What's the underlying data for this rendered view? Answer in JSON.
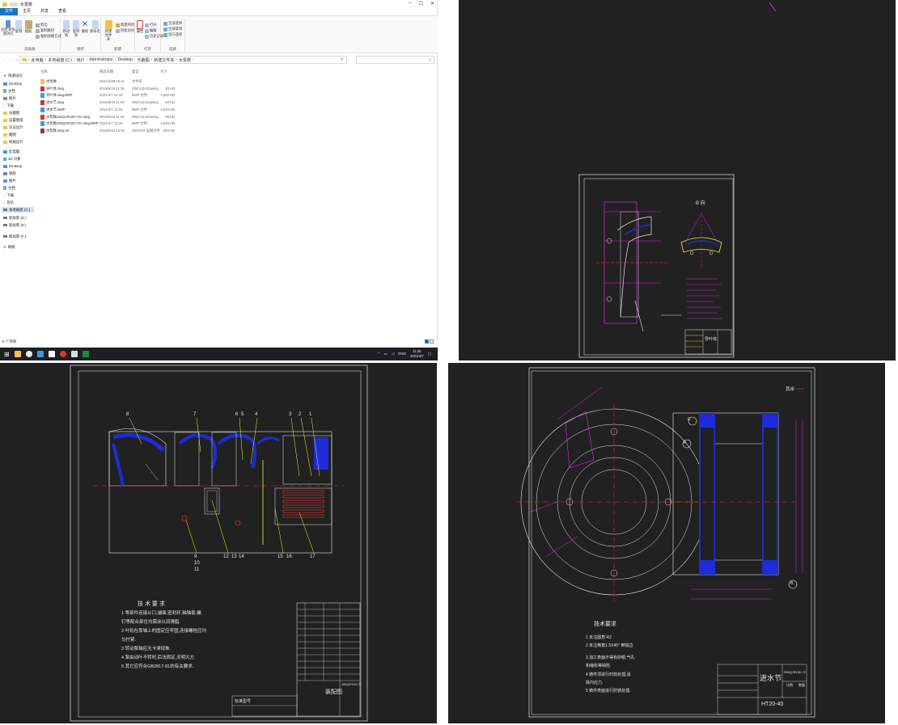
{
  "explorer": {
    "window_title": "水泵数",
    "ribbon_tabs": [
      "文件",
      "主页",
      "共享",
      "查看"
    ],
    "ribbon": {
      "pin_label": "固定到快速访问",
      "copy_label": "复制",
      "paste_label": "粘贴",
      "copy_path_label": "复制路径",
      "paste_shortcut_label": "粘贴快捷方式",
      "cut_label": "剪切",
      "move_to_label": "移动到",
      "copy_to_label": "复制到",
      "delete_label": "删除",
      "rename_label": "重命名",
      "new_folder_label": "新建文件夹",
      "new_item_label": "新建项目",
      "easy_access_label": "轻松访问",
      "properties_label": "属性",
      "open_label": "打开",
      "edit_label": "编辑",
      "history_label": "历史记录",
      "select_all_label": "全部选择",
      "select_none_label": "全部取消",
      "invert_selection_label": "反向选择",
      "group_clipboard": "剪贴板",
      "group_organize": "组织",
      "group_new": "新建",
      "group_open": "打开",
      "group_select": "选择"
    },
    "address": {
      "crumbs": [
        "此电脑",
        "本地磁盘 (C:)",
        "用户",
        "Administrator",
        "Desktop",
        "乐趣图",
        "新建文件夹",
        "水泵数"
      ]
    },
    "nav": {
      "items": [
        "快速访问",
        "Desktop",
        "文档",
        "图片",
        "下载",
        "乐趣图",
        "设置图纸",
        "毕业设计",
        "截图",
        "机械设计",
        "此电脑",
        "3D 对象",
        "Desktop",
        "视频",
        "图片",
        "文档",
        "下载",
        "音乐",
        "本地磁盘 (C:)",
        "新加卷 (D:)",
        "新加卷 (E:)",
        "新加卷 (F:)",
        "网络"
      ]
    },
    "columns": [
      "名称",
      "修改日期",
      "类型",
      "大小"
    ],
    "files": [
      {
        "name": "水泵数",
        "date": "2021/1/28 15:21",
        "type": "文件夹",
        "size": ""
      },
      {
        "name": "导叶体.dwg",
        "date": "2019/6/19 11:26",
        "type": "ZWCAD.Drawing",
        "size": "83 KB"
      },
      {
        "name": "导叶体.dwg.BMP",
        "date": "2021/4/7 11:03",
        "type": "BMP 文件",
        "size": "4,620 KB"
      },
      {
        "name": "进水节.dwg",
        "date": "2019/6/19 11:26",
        "type": "ZWCAD.Drawing",
        "size": "83 KB"
      },
      {
        "name": "进水节.BMP",
        "date": "2021/4/7 11:03",
        "type": "BMP 文件",
        "size": "4,620 KB"
      },
      {
        "name": "水泵数250QJR100-72A.dwg",
        "date": "2019/6/19 11:26",
        "type": "ZWCAD.Drawing",
        "size": "95 KB"
      },
      {
        "name": "水泵数250QJR100-72A.dwg.BMP",
        "date": "2021/4/7 11:03",
        "type": "BMP 文件",
        "size": "4,620 KB"
      },
      {
        "name": "水泵数.dwg.rar",
        "date": "2019/6/24 21:00",
        "type": "WinRAR 压缩文件",
        "size": "263 KB"
      }
    ],
    "status_text": "8 个项目"
  },
  "taskbar": {
    "tray_lang": "ENG",
    "time": "11:26",
    "date": "2021/4/7"
  },
  "drawings": {
    "top_right": {
      "view_label": "B 向",
      "part_name": "导叶体"
    },
    "bottom_left": {
      "balloons": [
        "8",
        "7",
        "6",
        "5",
        "4",
        "3",
        "2",
        "1",
        "9",
        "10",
        "11",
        "12",
        "13",
        "14",
        "15",
        "16",
        "17"
      ],
      "tech_title": "技 术 要 求",
      "tech_notes": [
        "1 零部件连接止口,端面,密封环,轴轴套,螺",
        "钉等配合部位均需涂以润滑脂.",
        "2 叶轮在泵轴上的固定应牢固,连接螺栓应均",
        "匀拧紧.",
        "3 转动泵轴应无卡滞现象.",
        "4 泵由动叶不转时,后法周定,灵明大方.",
        "5 其它应符合GB2817-81的有关要求."
      ],
      "title_name": "装配图",
      "drawing_no": "250QJR100-72",
      "label_a": "标准型号"
    },
    "bottom_right": {
      "corner_note": "其余",
      "tech_title": "技术要求",
      "tech_notes": [
        "1 未注圆角 R2",
        "2 未注倒角1.5X45° 倒锐边",
        "3 加工表面不得有砂眼,气孔",
        "和缩松等缺陷.",
        "4 铸件须进行时效处理,消",
        "除内应力.",
        "5 铸件表面进行防锈处理."
      ],
      "part_name": "进水节",
      "drawing_no": "250QJR100-72",
      "material": "HT20-40",
      "scale_label": "比例",
      "qty_label": "数量",
      "section_labels": [
        "A",
        "B",
        "C"
      ]
    }
  },
  "colors": {
    "cad_bg": "#212121",
    "cad_magenta": "#ff2bff",
    "cad_blue": "#1f2bd6",
    "cad_red": "#ff3030",
    "cad_yellow": "#f5f542",
    "cad_white": "#e8e8e8",
    "accent": "#1a73c7"
  }
}
